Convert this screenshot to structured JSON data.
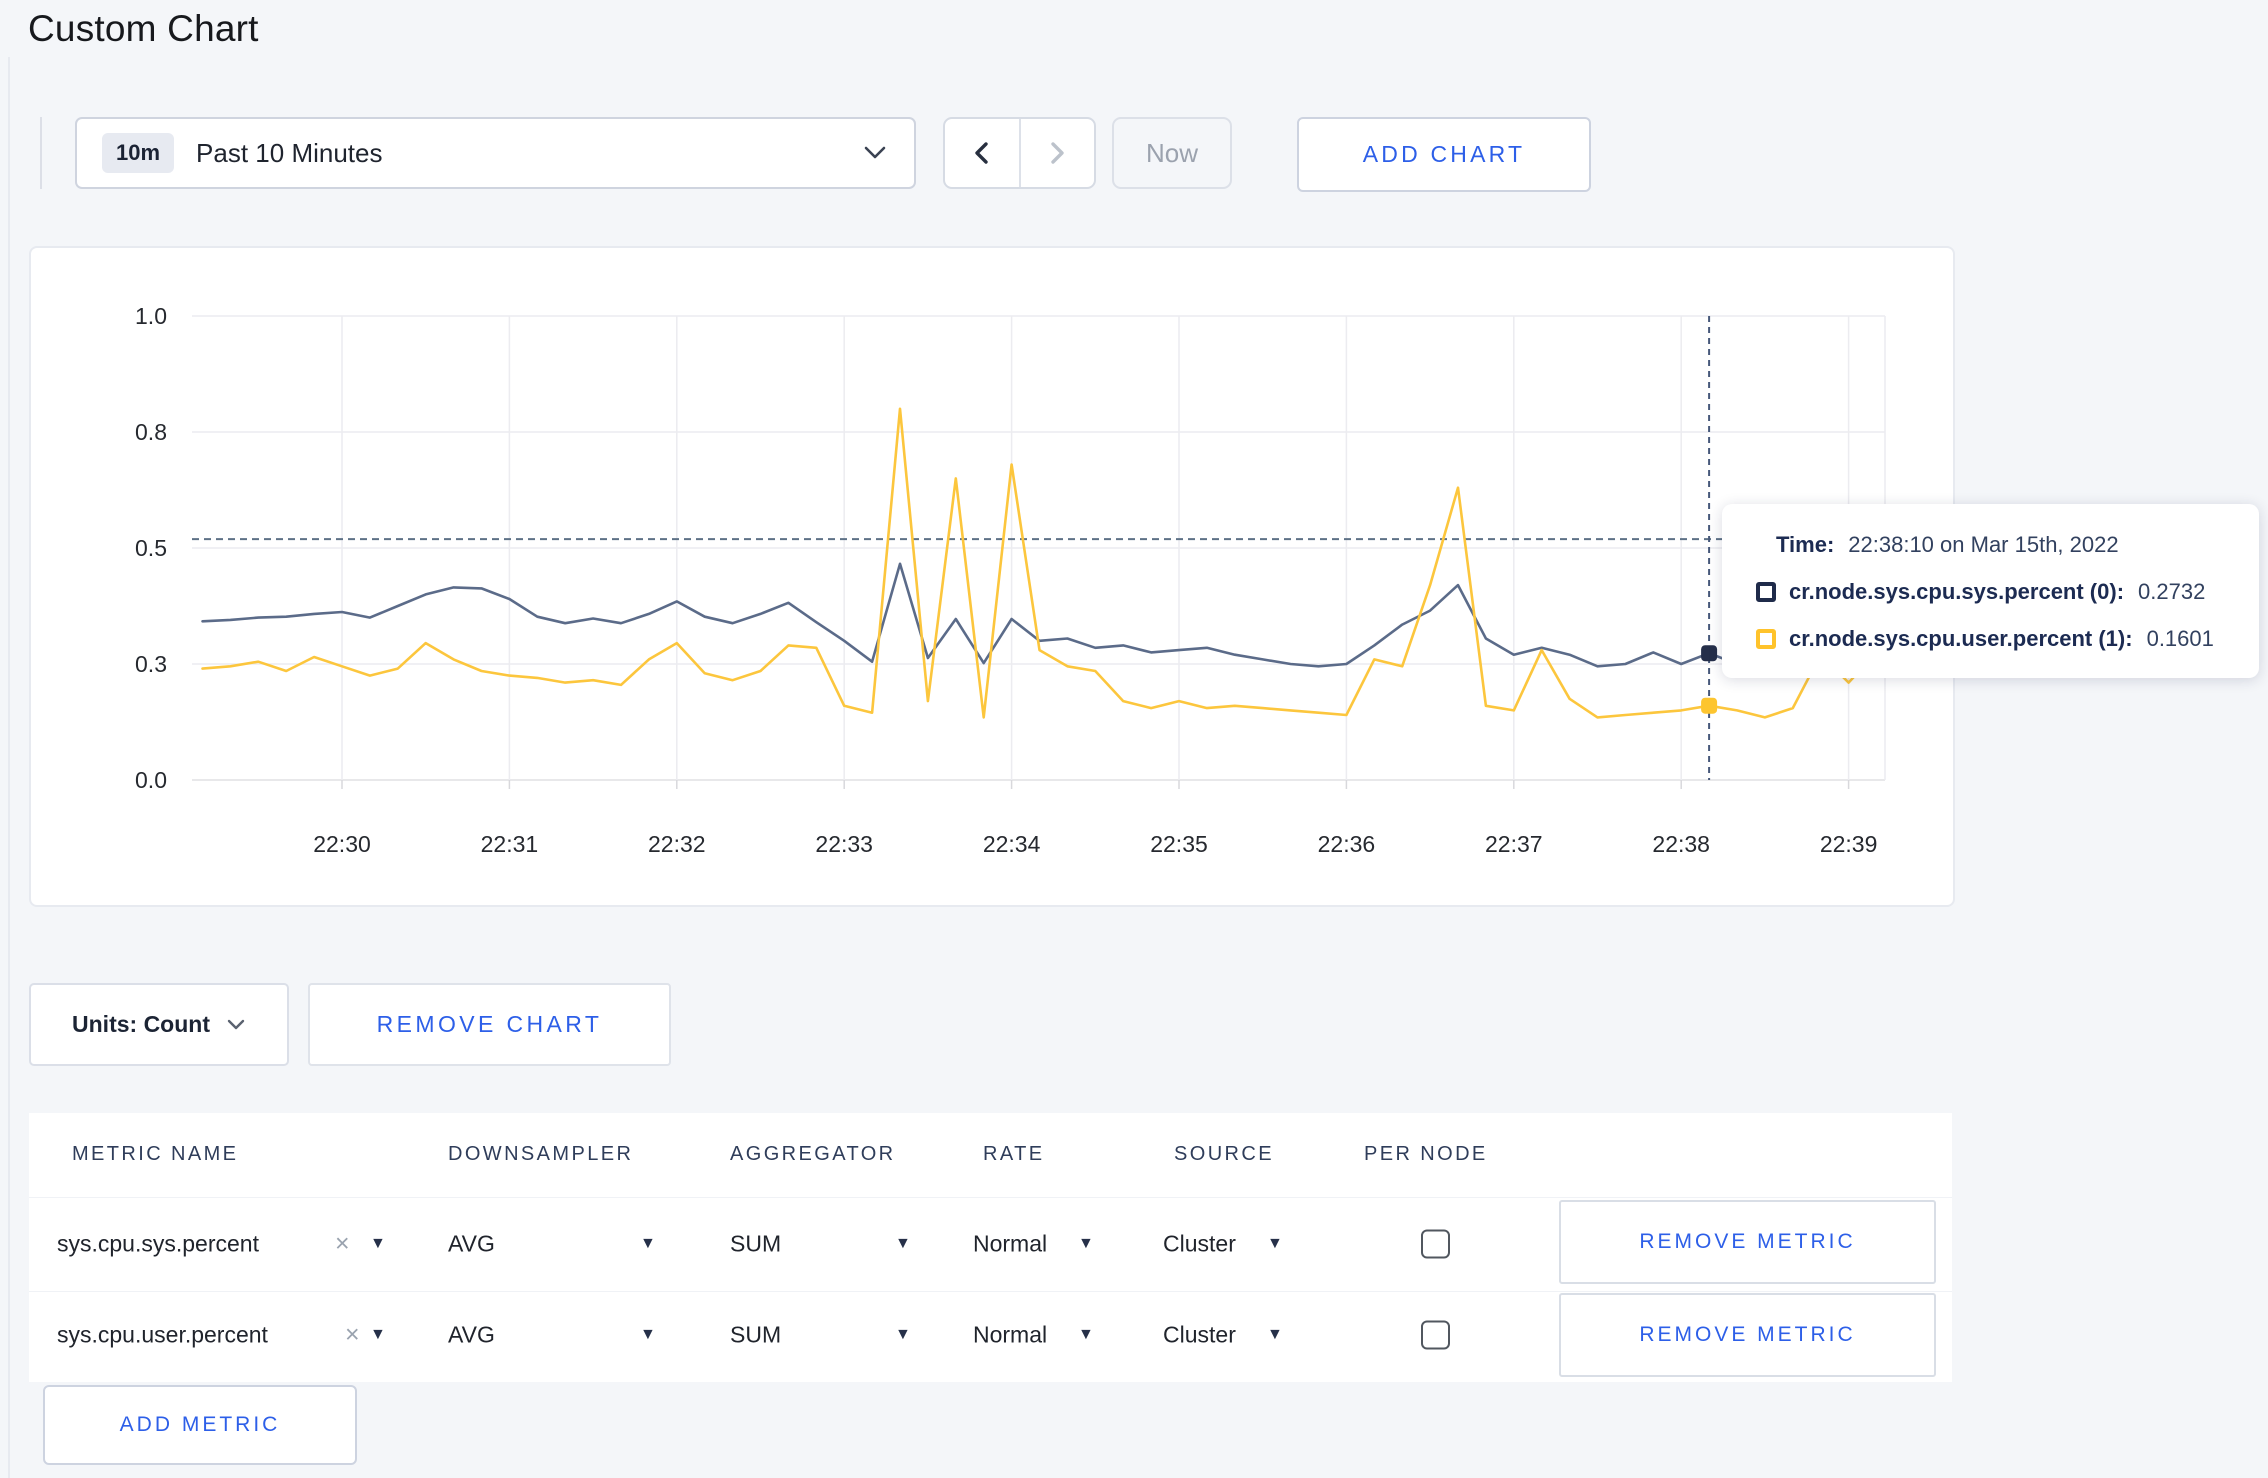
{
  "header": {
    "title": "Custom Chart"
  },
  "toolbar": {
    "time_badge": "10m",
    "time_label": "Past 10 Minutes",
    "now_label": "Now",
    "add_chart_label": "ADD CHART"
  },
  "chart_data": {
    "type": "line",
    "title": "",
    "x_start": "22:29:10",
    "x_interval_seconds": 10,
    "x_tick_labels": [
      "22:30",
      "22:31",
      "22:32",
      "22:33",
      "22:34",
      "22:35",
      "22:36",
      "22:37",
      "22:38",
      "22:39"
    ],
    "y_tick_labels": [
      "0.0",
      "0.3",
      "0.5",
      "0.8",
      "1.0"
    ],
    "y_tick_values": [
      0,
      0.25,
      0.5,
      0.75,
      1.0
    ],
    "ylim": [
      0,
      1
    ],
    "grid": true,
    "threshold_line": 0.519,
    "series": [
      {
        "name": "cr.node.sys.cpu.sys.percent",
        "color": "#5b6b89",
        "dot_color": "#252f4a",
        "values": [
          0.342,
          0.345,
          0.35,
          0.352,
          0.358,
          0.362,
          0.35,
          0.375,
          0.4,
          0.415,
          0.413,
          0.39,
          0.352,
          0.338,
          0.348,
          0.338,
          0.358,
          0.385,
          0.352,
          0.338,
          0.358,
          0.382,
          0.34,
          0.3,
          0.255,
          0.466,
          0.263,
          0.347,
          0.252,
          0.347,
          0.3,
          0.305,
          0.285,
          0.29,
          0.275,
          0.28,
          0.285,
          0.27,
          0.26,
          0.25,
          0.245,
          0.25,
          0.29,
          0.335,
          0.365,
          0.42,
          0.305,
          0.27,
          0.285,
          0.27,
          0.245,
          0.25,
          0.275,
          0.25,
          0.2732,
          0.25,
          0.265,
          0.29,
          0.255,
          0.25,
          0.275
        ]
      },
      {
        "name": "cr.node.sys.cpu.user.percent",
        "color": "#fcc63d",
        "dot_color": "#fdc52f",
        "values": [
          0.24,
          0.245,
          0.255,
          0.235,
          0.265,
          0.245,
          0.225,
          0.24,
          0.295,
          0.26,
          0.235,
          0.225,
          0.22,
          0.21,
          0.215,
          0.205,
          0.26,
          0.295,
          0.23,
          0.215,
          0.235,
          0.29,
          0.285,
          0.16,
          0.145,
          0.8,
          0.17,
          0.65,
          0.135,
          0.68,
          0.28,
          0.245,
          0.235,
          0.17,
          0.155,
          0.17,
          0.155,
          0.16,
          0.155,
          0.15,
          0.145,
          0.14,
          0.26,
          0.245,
          0.42,
          0.63,
          0.16,
          0.15,
          0.28,
          0.175,
          0.135,
          0.14,
          0.145,
          0.15,
          0.1601,
          0.15,
          0.135,
          0.155,
          0.27,
          0.21,
          0.275
        ]
      }
    ],
    "crosshair": {
      "time": "22:38:10",
      "values": [
        0.2732,
        0.1601
      ]
    }
  },
  "tooltip": {
    "time_label": "Time:",
    "time_value": "22:38:10 on Mar 15th, 2022",
    "rows": [
      {
        "label": "cr.node.sys.cpu.sys.percent (0):",
        "value": "0.2732",
        "color": "#1f2b4a"
      },
      {
        "label": "cr.node.sys.cpu.user.percent (1):",
        "value": "0.1601",
        "color": "#ffc32b"
      }
    ]
  },
  "chart_controls": {
    "units_label": "Units: Count",
    "remove_chart_label": "REMOVE CHART"
  },
  "icons": {
    "clear_glyph": "×",
    "caret_glyph": "▼"
  },
  "metrics_table": {
    "columns": [
      "METRIC NAME",
      "DOWNSAMPLER",
      "AGGREGATOR",
      "RATE",
      "SOURCE",
      "PER NODE"
    ],
    "rows": [
      {
        "metric": "sys.cpu.sys.percent",
        "downsampler": "AVG",
        "aggregator": "SUM",
        "rate": "Normal",
        "source": "Cluster",
        "per_node_checked": false,
        "remove_label": "REMOVE METRIC"
      },
      {
        "metric": "sys.cpu.user.percent",
        "downsampler": "AVG",
        "aggregator": "SUM",
        "rate": "Normal",
        "source": "Cluster",
        "per_node_checked": false,
        "remove_label": "REMOVE METRIC"
      }
    ],
    "add_metric_label": "ADD METRIC"
  },
  "colors": {
    "accent_blue": "#2d5fe8",
    "page_bg": "#f4f6f9",
    "series_sys": "#5b6b89",
    "series_user": "#fcc63d"
  }
}
